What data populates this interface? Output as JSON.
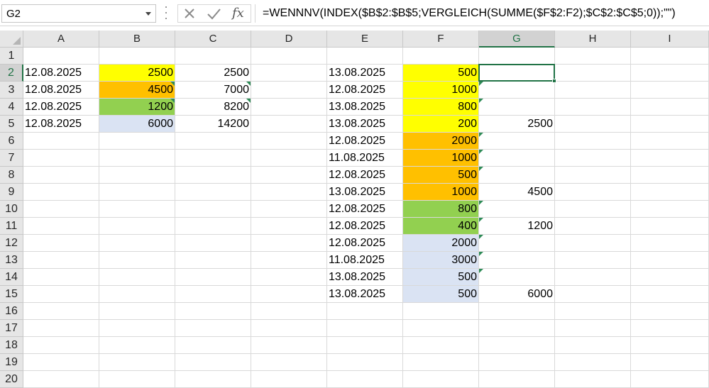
{
  "name_box": {
    "value": "G2"
  },
  "formula_bar": {
    "cancel_icon": "x-icon",
    "enter_icon": "check-icon",
    "function_label": "fx",
    "formula": "=WENNNV(INDEX($B$2:$B$5;VERGLEICH(SUMME($F$2:F2);$C$2:$C$5;0));\"\")"
  },
  "columns": [
    "A",
    "B",
    "C",
    "D",
    "E",
    "F",
    "G",
    "H",
    "I"
  ],
  "selected_column": "G",
  "selected_row": "2",
  "rows": [
    "1",
    "2",
    "3",
    "4",
    "5",
    "6",
    "7",
    "8",
    "9",
    "10",
    "11",
    "12",
    "13",
    "14",
    "15",
    "16",
    "17",
    "18",
    "19",
    "20"
  ],
  "colors": {
    "yellow": "#ffff00",
    "orange": "#ffc000",
    "green": "#92d050",
    "blue": "#dae3f3",
    "selection": "#217346"
  },
  "cells": {
    "A2": "12.08.2025",
    "A3": "12.08.2025",
    "A4": "12.08.2025",
    "A5": "12.08.2025",
    "B2": "2500",
    "B3": "4500",
    "B4": "1200",
    "B5": "6000",
    "C2": "2500",
    "C3": "7000",
    "C4": "8200",
    "C5": "14200",
    "E2": "13.08.2025",
    "E3": "12.08.2025",
    "E4": "13.08.2025",
    "E5": "13.08.2025",
    "E6": "12.08.2025",
    "E7": "11.08.2025",
    "E8": "12.08.2025",
    "E9": "13.08.2025",
    "E10": "12.08.2025",
    "E11": "12.08.2025",
    "E12": "12.08.2025",
    "E13": "11.08.2025",
    "E14": "13.08.2025",
    "E15": "13.08.2025",
    "F2": "500",
    "F3": "1000",
    "F4": "800",
    "F5": "200",
    "F6": "2000",
    "F7": "1000",
    "F8": "500",
    "F9": "1000",
    "F10": "800",
    "F11": "400",
    "F12": "2000",
    "F13": "3000",
    "F14": "500",
    "F15": "500",
    "G5": "2500",
    "G9": "4500",
    "G11": "1200",
    "G15": "6000"
  },
  "fills": {
    "B2": "yellow",
    "B3": "orange",
    "B4": "green",
    "B5": "blue",
    "F2": "yellow",
    "F3": "yellow",
    "F4": "yellow",
    "F5": "yellow",
    "F6": "orange",
    "F7": "orange",
    "F8": "orange",
    "F9": "orange",
    "F10": "green",
    "F11": "green",
    "F12": "blue",
    "F13": "blue",
    "F14": "blue",
    "F15": "blue"
  },
  "error_markers": [
    "B3",
    "B4",
    "C3",
    "C4",
    "G3",
    "G4",
    "G6",
    "G7",
    "G8",
    "G10",
    "G11",
    "G12",
    "G13",
    "G14"
  ],
  "active_cell": "G2"
}
